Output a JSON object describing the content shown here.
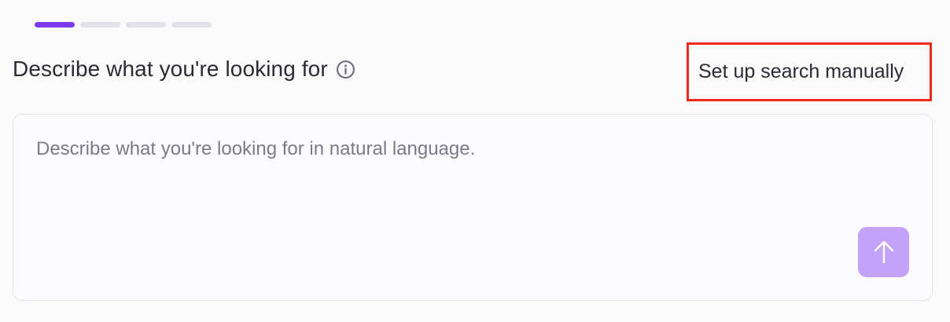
{
  "stepper": {
    "total_steps": 4,
    "current_step": 1,
    "active_color": "#7c3aed",
    "inactive_color": "#e2e1e8"
  },
  "header": {
    "title": "Describe what you're looking for",
    "info_icon": "info-icon"
  },
  "manual_link": {
    "label": "Set up search manually",
    "highlight_color": "#ee2a1a"
  },
  "query_input": {
    "value": "",
    "placeholder": "Describe what you're looking for in natural language."
  },
  "send_button": {
    "icon": "arrow-up-icon",
    "color": "#c4a2fa"
  }
}
